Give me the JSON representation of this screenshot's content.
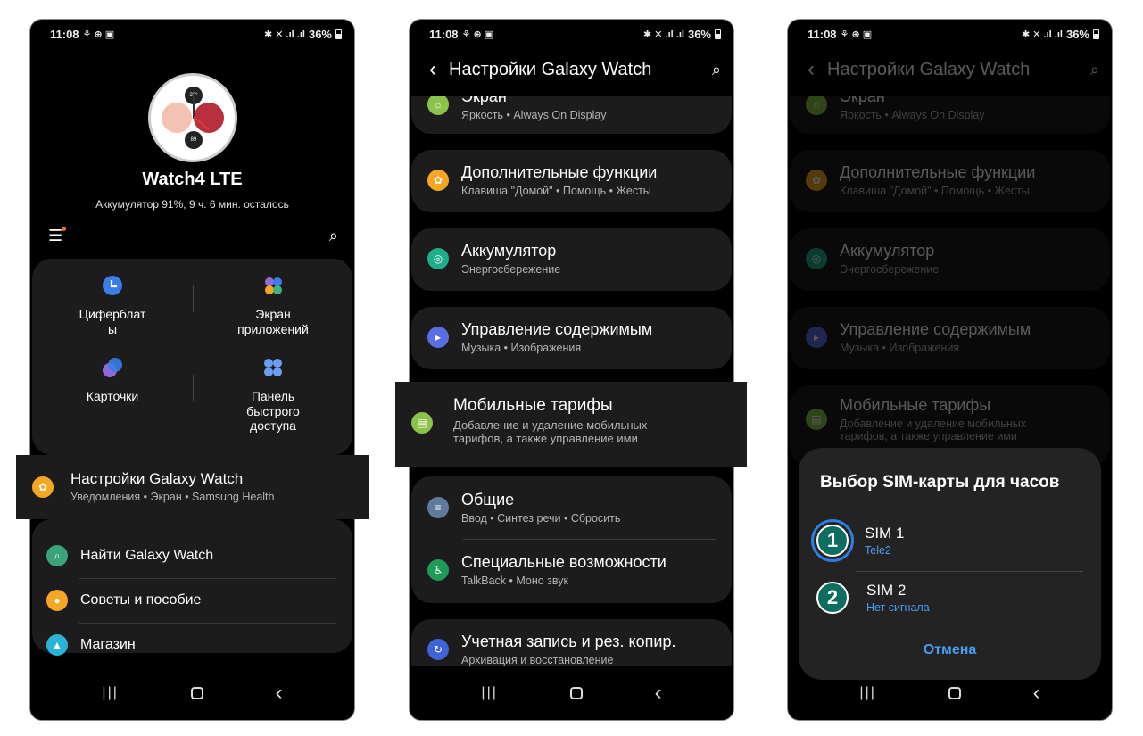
{
  "status": {
    "time": "11:08",
    "battery": "36%"
  },
  "phone1": {
    "device_name": "Watch4 LTE",
    "battery_info": "Аккумулятор 91%, 9 ч. 6 мин. осталось",
    "watch_face": {
      "top": "23°",
      "bottom": "89"
    },
    "quick": [
      {
        "label": "Циферблат\nы"
      },
      {
        "label": "Экран\nприложений"
      },
      {
        "label": "Карточки"
      },
      {
        "label": "Панель\nбыстрого\nдоступа"
      }
    ],
    "highlight": {
      "title": "Настройки Galaxy Watch",
      "subtitle": "Уведомления • Экран • Samsung Health"
    },
    "list": [
      {
        "label": "Найти Galaxy Watch"
      },
      {
        "label": "Советы и пособие"
      },
      {
        "label": "Магазин"
      }
    ]
  },
  "settings": {
    "header_title": "Настройки Galaxy Watch",
    "items": [
      {
        "title": "Экран",
        "subtitle": "Яркость • Always On Display"
      },
      {
        "title": "Дополнительные функции",
        "subtitle": "Клавиша \"Домой\" • Помощь • Жесты"
      },
      {
        "title": "Аккумулятор",
        "subtitle": "Энергосбережение"
      },
      {
        "title": "Управление содержимым",
        "subtitle": "Музыка • Изображения"
      },
      {
        "title": "Мобильные тарифы",
        "subtitle": "Добавление и удаление мобильных тарифов, а также управление ими"
      },
      {
        "title": "Общие",
        "subtitle": "Ввод • Синтез речи • Сбросить"
      },
      {
        "title": "Специальные возможности",
        "subtitle": "TalkBack • Моно звук"
      },
      {
        "title": "Учетная запись и рез. копир.",
        "subtitle": "Архивация и восстановление"
      }
    ],
    "mobile_sub_line1": "Добавление и удаление мобильных",
    "mobile_sub_line2": "тарифов, а также управление ими"
  },
  "dialog": {
    "title": "Выбор SIM-карты для часов",
    "sims": [
      {
        "badge": "1",
        "name": "SIM 1",
        "carrier": "Tele2"
      },
      {
        "badge": "2",
        "name": "SIM 2",
        "carrier": "Нет сигнала"
      }
    ],
    "cancel_label": "Отмена"
  },
  "colors": {
    "accent_blue": "#4a9df0",
    "card": "#1c1c1c",
    "orange": "#f5a623",
    "green": "#3aa37a"
  }
}
